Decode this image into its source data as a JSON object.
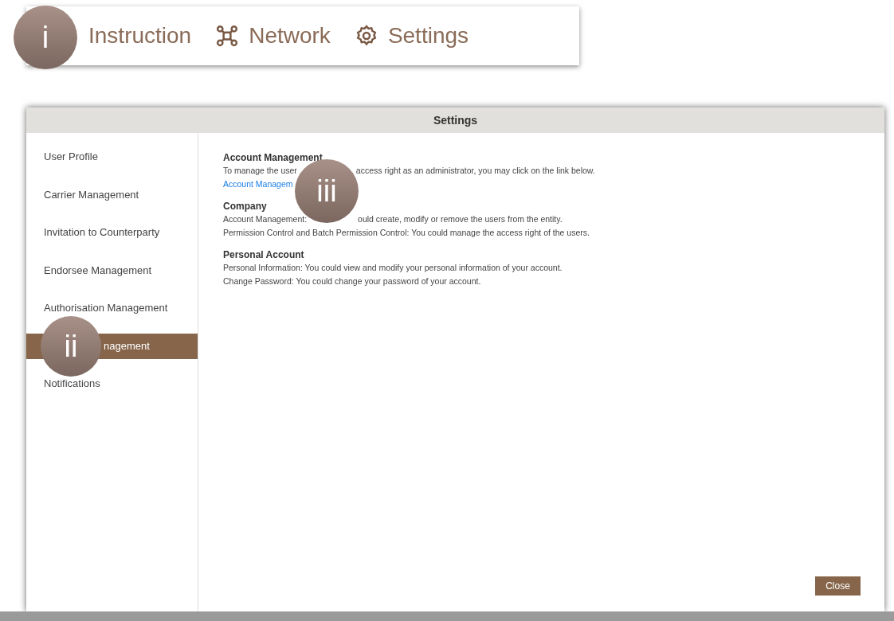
{
  "top_nav": [
    {
      "kind": "text",
      "label": "Instruction"
    },
    {
      "kind": "network",
      "label": "Network"
    },
    {
      "kind": "settings",
      "label": "Settings"
    }
  ],
  "dialog": {
    "title": "Settings",
    "sidebar": [
      {
        "label": "User Profile",
        "selected": false
      },
      {
        "label": "Carrier Management",
        "selected": false
      },
      {
        "label": "Invitation to Counterparty",
        "selected": false
      },
      {
        "label": "Endorsee Management",
        "selected": false
      },
      {
        "label": "Authorisation Management",
        "selected": false
      },
      {
        "label": "nagement",
        "selected": true
      },
      {
        "label": "Notifications",
        "selected": false
      }
    ],
    "sections": [
      {
        "heading": "Account Management",
        "lines": [
          [
            "To manage the user",
            "access right as an administrator, you may click on the link below."
          ]
        ],
        "link": "Account Managem"
      },
      {
        "heading": "Company",
        "lines": [
          [
            "Account Management:",
            "ould create, modify or remove the users from the entity."
          ],
          [
            "Permission Control and Batch Permission Control: You could manage the access right of the users."
          ]
        ]
      },
      {
        "heading": "Personal Account",
        "lines": [
          [
            "Personal Information: You could view and modify your personal information of your account."
          ],
          [
            "Change Password: You could change your password of your account."
          ]
        ]
      }
    ],
    "close_button": "Close"
  },
  "callouts": [
    {
      "label": "i"
    },
    {
      "label": "ii"
    },
    {
      "label": "iii"
    }
  ]
}
